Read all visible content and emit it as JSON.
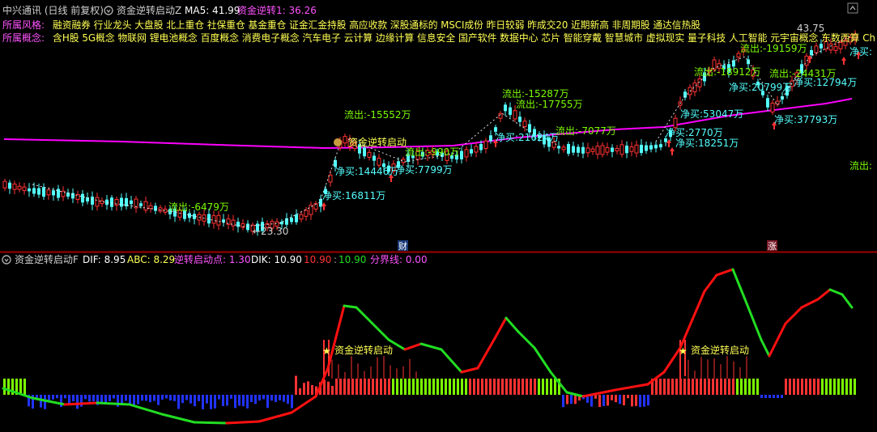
{
  "top_panel": {
    "stock_title": "中兴通讯 (日线 前复权)",
    "indicator_name": "资金逆转启动Z",
    "ma5_label": "MA5: 41.99",
    "signal_label": "资金逆转1: 36.26",
    "style_label": "所属风格:",
    "style_text": "融资融券 行业龙头 大盘股 北上重仓 社保重仓 基金重仓 证金汇金持股 高应收款 深股通标的 MSCI成份 昨日较弱 昨成交20 近期新高 非周期股 通达信热股",
    "concept_label": "所属概念:",
    "concept_text": "含H股 5G概念 物联网 锂电池概念 百度概念 消费电子概念 汽车电子 云计算 边缘计算 信息安全 国产软件 数据中心 芯片 智能穿戴 智慧城市 虚拟现实 量子科技 人工智能 元宇宙概念 东数西算 Ch",
    "high_label": "43.75",
    "low_label": "←23.30",
    "marker_cai": "财",
    "marker_zhang": "涨",
    "annotations": [
      "流出:-6479万",
      "流出:-15552万",
      "资金逆转启动",
      "净买:14446万",
      "净买:16811万",
      "净买:7799万",
      "流出:-990万",
      "流出:-15287万",
      "流出:-17755万",
      "净买:21624万",
      "流出:-7077万",
      "净买:2770万",
      "净买:18251万",
      "净买:53047万",
      "流出:-18912万",
      "净买:20799万",
      "流出:-24431万",
      "流出:-19159万",
      "净买:12794万",
      "净买:37793万",
      "流出:",
      "净买:"
    ]
  },
  "bottom_panel": {
    "indicator_name": "资金逆转启动F",
    "dif_label": "DIF: 8.95",
    "abc_label": "ABC: 8.29",
    "start_point_label": "逆转启动点: 1.30",
    "dik_label": "DIK: 10.90",
    "dik_value_red": "10.90",
    "dik_value_green": "10.90",
    "divider_label": "分界线: 0.00",
    "signal_text": "资金逆转启动"
  },
  "colors": {
    "up": "#ff3232",
    "down": "#54ffff",
    "ma_line": "#ff00ff",
    "annotation_green": "#7cfc00",
    "annotation_cyan": "#54ffff",
    "label_yellow": "#ffff54",
    "label_magenta": "#ff54ff",
    "dif_line_green": "#22dd22",
    "dif_line_red": "#ff1010",
    "separator": "#a00000"
  },
  "icons": [
    "gear-icon",
    "up-arrow-icon",
    "star-icon",
    "money-bag-icon"
  ]
}
